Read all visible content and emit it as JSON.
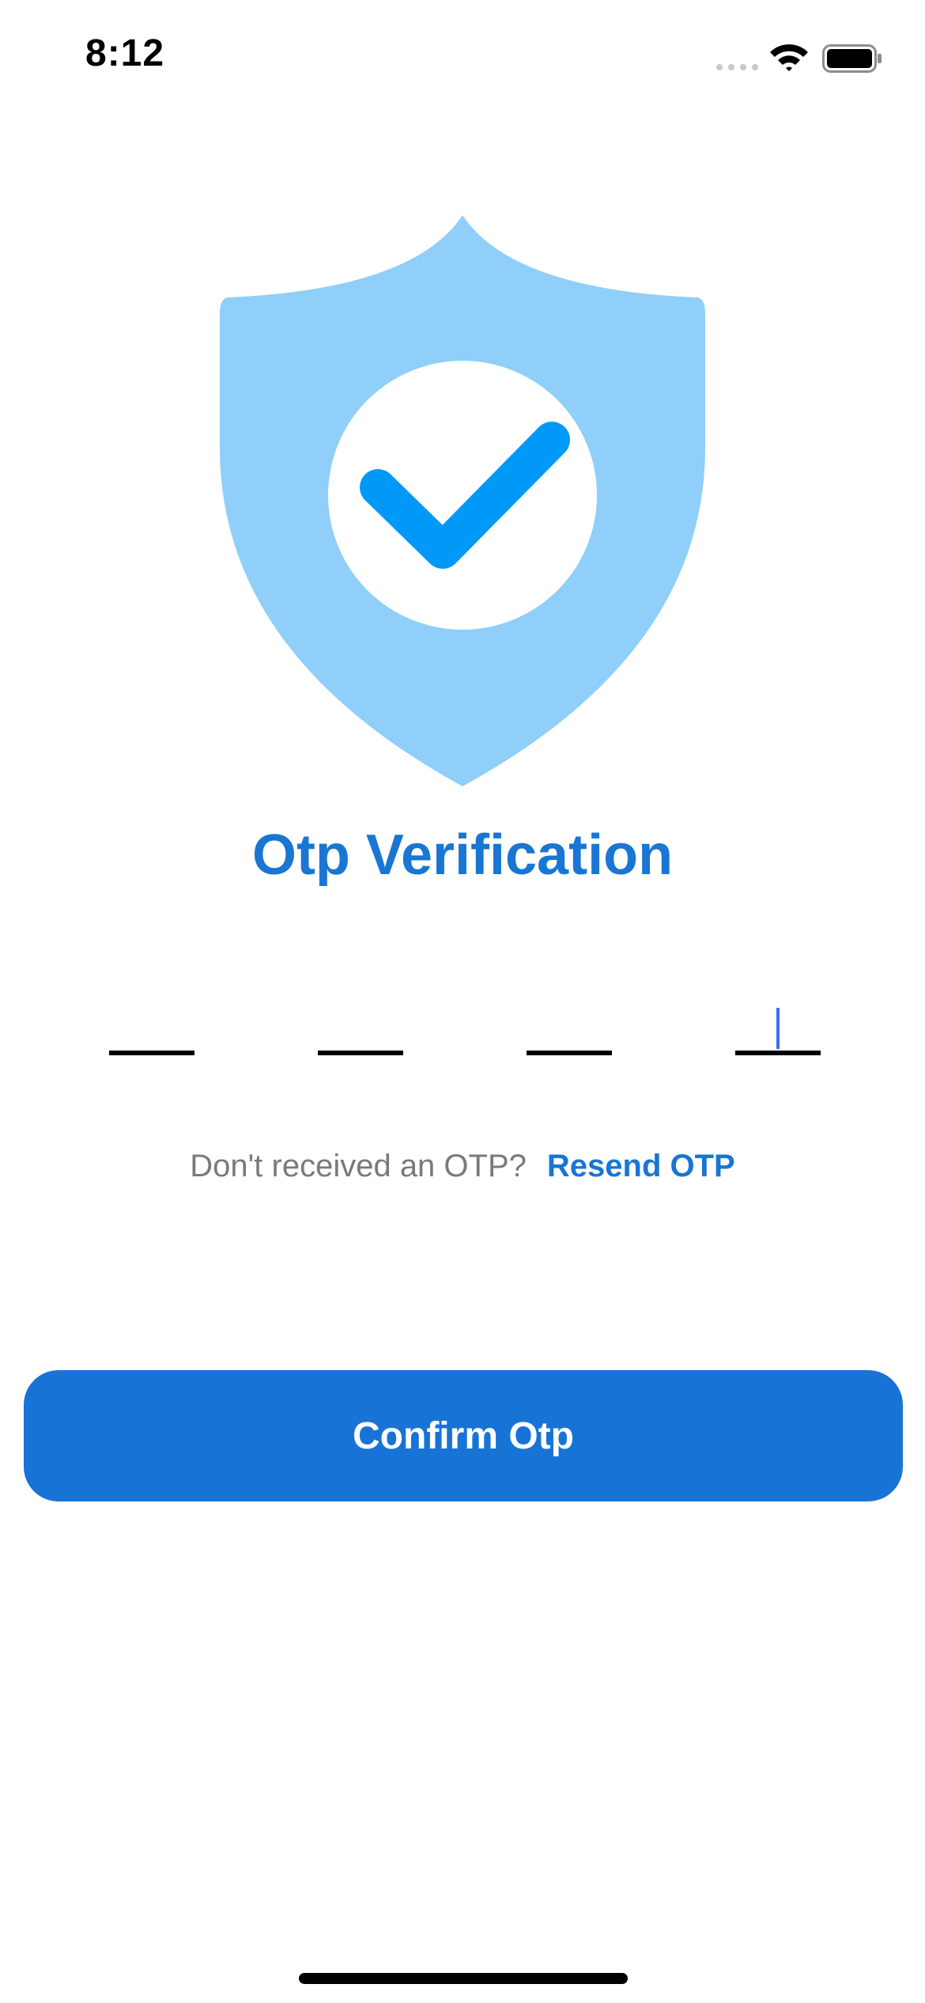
{
  "status_bar": {
    "time": "8:12"
  },
  "icons": {
    "illustration": "shield-check-icon",
    "wifi": "wifi-icon",
    "battery": "battery-icon",
    "signal": "cellular-signal-icon"
  },
  "colors": {
    "accent": "#1976d2",
    "button": "#1873d6",
    "shield_light": "#8fcff9",
    "check": "#0099f7",
    "caret": "#3a6ff7",
    "muted_text": "#7a7a7a"
  },
  "main": {
    "title": "Otp Verification",
    "otp": {
      "digits": [
        "",
        "",
        "",
        ""
      ],
      "focused_index": 3
    },
    "resend": {
      "prompt": "Don't received an OTP?",
      "link_label": "Resend OTP"
    },
    "confirm_label": "Confirm Otp"
  }
}
